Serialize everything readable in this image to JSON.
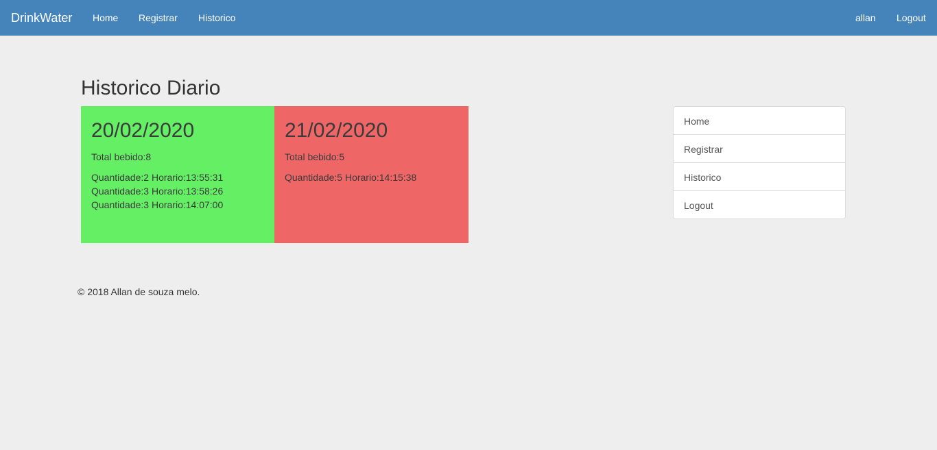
{
  "navbar": {
    "brand": "DrinkWater",
    "links": [
      "Home",
      "Registrar",
      "Historico"
    ],
    "user": "allan",
    "logout": "Logout",
    "background_color": "#4484bb"
  },
  "main": {
    "title": "Historico Diario",
    "days": [
      {
        "date": "20/02/2020",
        "total": "Total bebido:8",
        "entries": [
          "Quantidade:2 Horario:13:55:31",
          "Quantidade:3 Horario:13:58:26",
          "Quantidade:3 Horario:14:07:00"
        ],
        "color": "#64ef64"
      },
      {
        "date": "21/02/2020",
        "total": "Total bebido:5",
        "entries": [
          "Quantidade:5 Horario:14:15:38"
        ],
        "color": "#ef6666"
      }
    ]
  },
  "side_menu": {
    "items": [
      "Home",
      "Registrar",
      "Historico",
      "Logout"
    ]
  },
  "footer": {
    "text": "© 2018 Allan de souza melo."
  }
}
